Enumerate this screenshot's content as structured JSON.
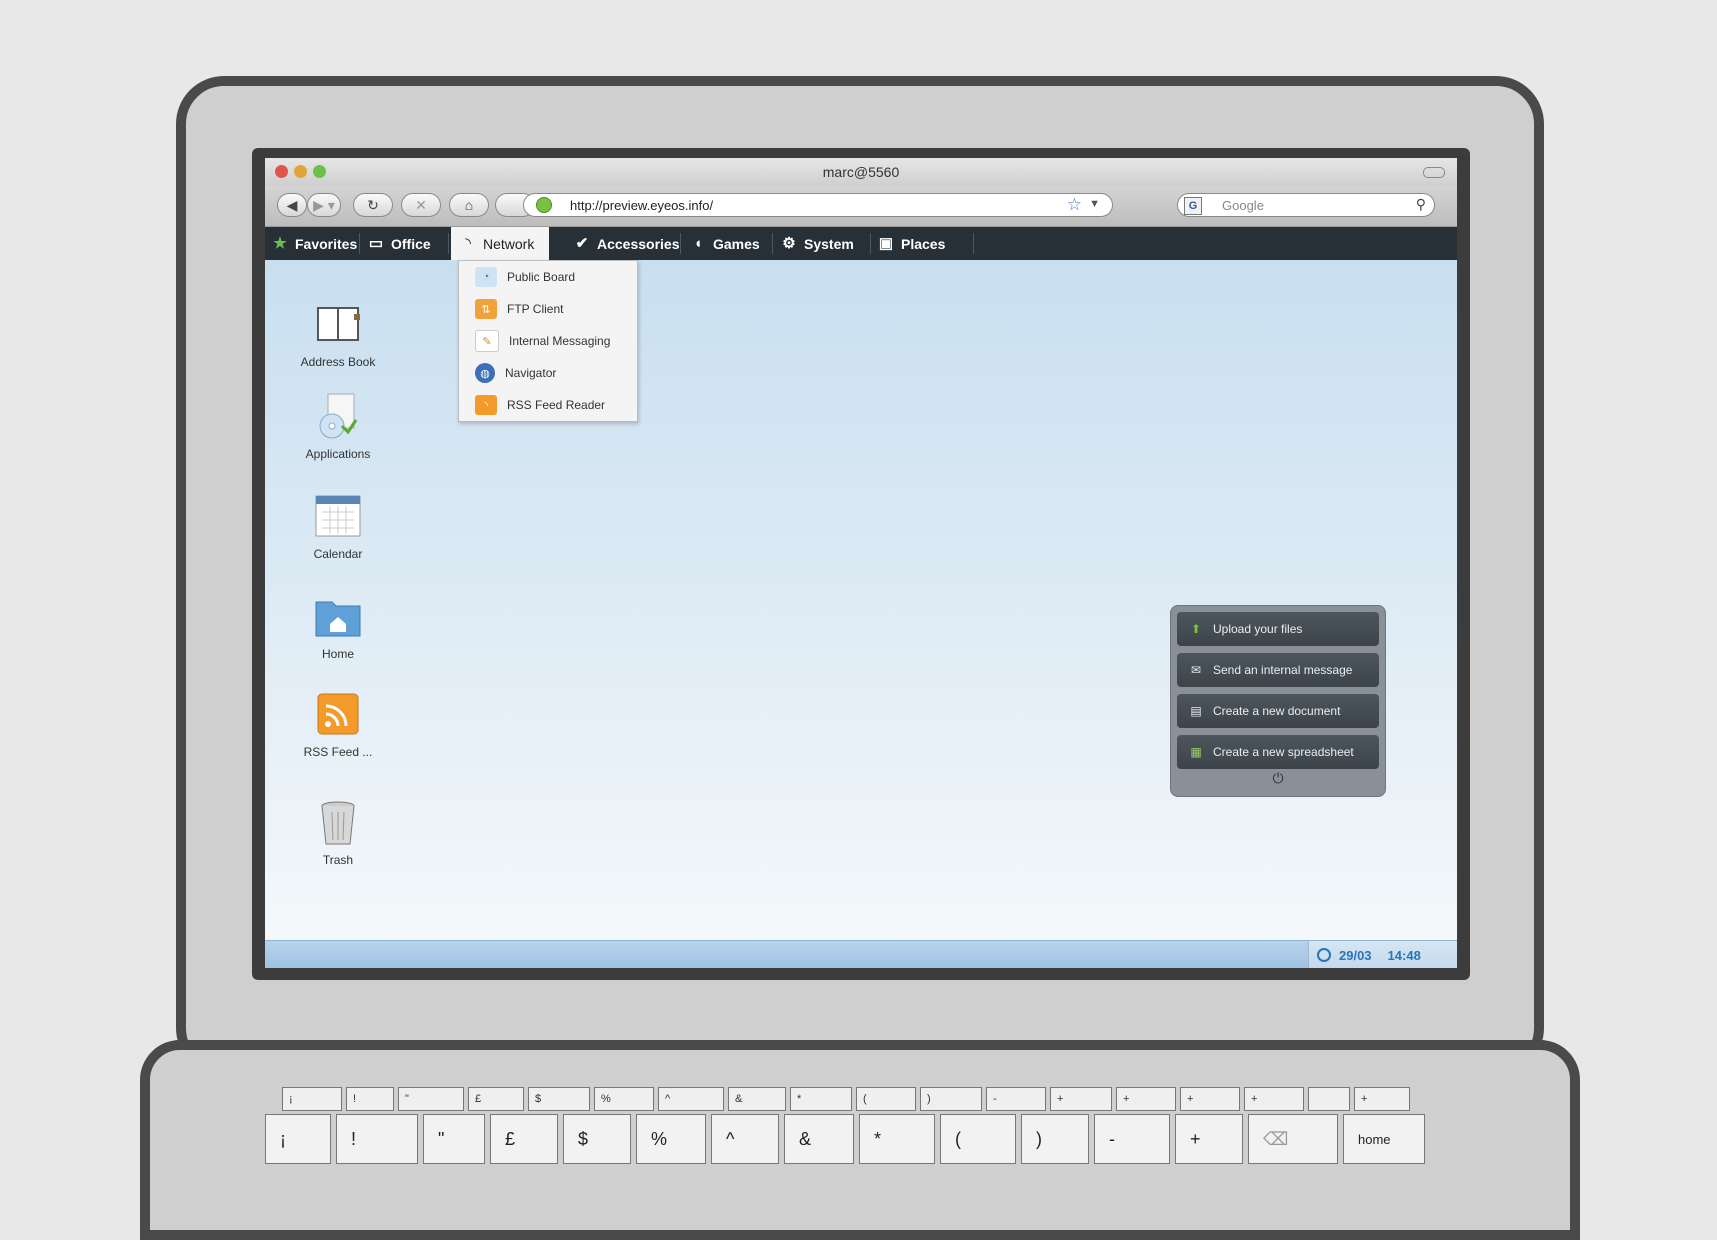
{
  "window": {
    "title": "marc@5560"
  },
  "browser": {
    "url": "http://preview.eyeos.info/",
    "search_placeholder": "Google",
    "search_engine_icon": "G"
  },
  "menubar": {
    "items": [
      {
        "label": "Favorites",
        "icon": "star-icon"
      },
      {
        "label": "Office",
        "icon": "briefcase-icon"
      },
      {
        "label": "Network",
        "icon": "rss-icon",
        "active": true
      },
      {
        "label": "Accessories",
        "icon": "check-circle-icon"
      },
      {
        "label": "Games",
        "icon": "gamepad-icon"
      },
      {
        "label": "System",
        "icon": "gear-icon"
      },
      {
        "label": "Places",
        "icon": "places-icon"
      }
    ]
  },
  "network_menu": {
    "items": [
      {
        "label": "Public Board"
      },
      {
        "label": "FTP Client"
      },
      {
        "label": "Internal Messaging"
      },
      {
        "label": "Navigator"
      },
      {
        "label": "RSS Feed Reader"
      }
    ]
  },
  "desktop_icons": [
    {
      "label": "Address Book"
    },
    {
      "label": "Applications"
    },
    {
      "label": "Calendar"
    },
    {
      "label": "Home"
    },
    {
      "label": "RSS Feed ..."
    },
    {
      "label": "Trash"
    }
  ],
  "quick_actions": {
    "items": [
      {
        "label": "Upload your files"
      },
      {
        "label": "Send an internal message"
      },
      {
        "label": "Create a new document"
      },
      {
        "label": "Create a new spreadsheet"
      }
    ],
    "power_glyph": "⏻"
  },
  "taskbar": {
    "date": "29/03",
    "time": "14:48"
  },
  "keyboard": {
    "top_row": [
      "¡",
      "!",
      "\"",
      "£",
      "$",
      "%",
      "^",
      "&",
      "*",
      "(",
      ")",
      "-",
      "+",
      "+",
      "+",
      "+",
      "",
      "+"
    ],
    "main_row": [
      "¡",
      "!",
      "\"",
      "£",
      "$",
      "%",
      "^",
      "&",
      "*",
      "(",
      ")",
      "-",
      "+",
      "",
      "home"
    ]
  },
  "colors": {
    "menubar_bg": "#263036",
    "desktop_top": "#c8dff0",
    "accent_blue": "#2a74b8"
  }
}
